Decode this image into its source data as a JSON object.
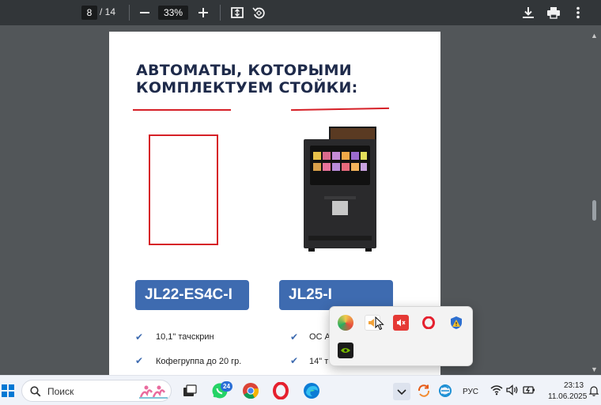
{
  "pdf_toolbar": {
    "current_page": "8",
    "total_pages": "/ 14",
    "zoom": "33%",
    "zoom_out_icon": "minus-icon",
    "zoom_in_icon": "plus-icon",
    "fit_icon": "fit-page-icon",
    "rotate_icon": "rotate-icon",
    "download_icon": "download-icon",
    "print_icon": "print-icon",
    "more_icon": "more-vertical-icon"
  },
  "page": {
    "heading_line1": "АВТОМАТЫ, КОТОРЫМИ",
    "heading_line2": "КОМПЛЕКТУЕМ СТОЙКИ:",
    "models": [
      {
        "label": "JL22-ES4C-I",
        "features": [
          "10,1\" тачскрин",
          "Кофегруппа до 20 гр."
        ]
      },
      {
        "label": "JL25-I",
        "features": [
          "ОС А",
          "14\" т"
        ]
      }
    ]
  },
  "tray_popup": {
    "icons": [
      "color-circle-icon",
      "audio-app-icon",
      "red-app-icon",
      "opera-icon",
      "security-shield-icon",
      "nvidia-icon"
    ]
  },
  "taskbar": {
    "search_placeholder": "Поиск",
    "whatsapp_badge": "24",
    "language": "РУС",
    "time": "23:13",
    "date": "11.06.2025"
  },
  "colors": {
    "accent_red": "#d62027",
    "badge_blue": "#3e6bb0",
    "heading_navy": "#1e2a4a"
  }
}
